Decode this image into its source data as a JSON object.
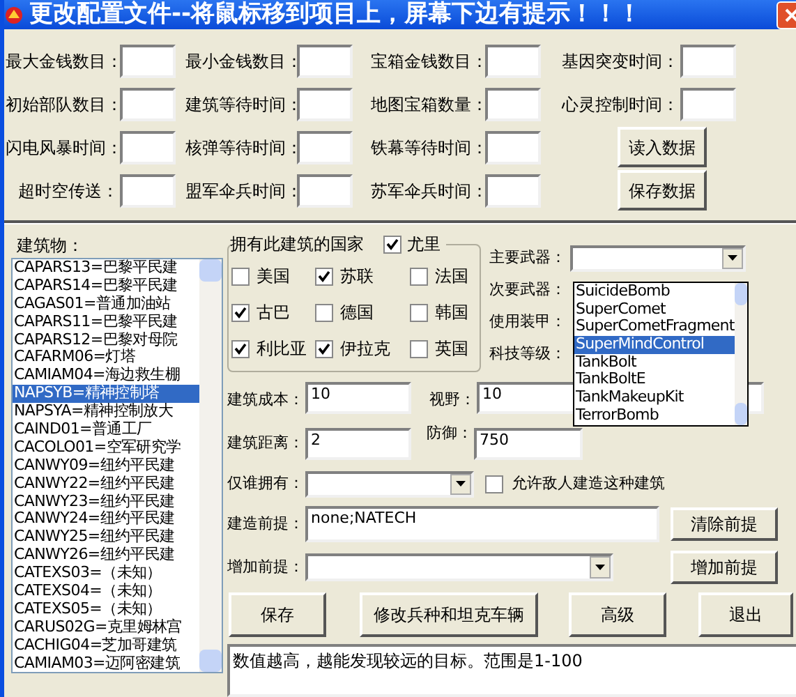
{
  "window": {
    "title": "更改配置文件--将鼠标移到项目上，屏幕下边有提示！！！"
  },
  "settings": [
    {
      "label": "最大金钱数目："
    },
    {
      "label": "最小金钱数目："
    },
    {
      "label": "宝箱金钱数目："
    },
    {
      "label": "基因突变时间："
    },
    {
      "label": "初始部队数目："
    },
    {
      "label": "建筑等待时间："
    },
    {
      "label": "地图宝箱数量："
    },
    {
      "label": "心灵控制时间："
    },
    {
      "label": "闪电风暴时间："
    },
    {
      "label": "核弹等待时间："
    },
    {
      "label": "铁幕等待时间："
    },
    {
      "label": "超时空传送："
    },
    {
      "label": "盟军伞兵时间："
    },
    {
      "label": "苏军伞兵时间："
    }
  ],
  "data_buttons": [
    "读入数据",
    "保存数据"
  ],
  "buildings": {
    "label": "建筑物：",
    "items": [
      {
        "text": "CAPARS13=巴黎平民建",
        "selected": false
      },
      {
        "text": "CAPARS14=巴黎平民建",
        "selected": false
      },
      {
        "text": "CAGAS01=普通加油站",
        "selected": false
      },
      {
        "text": "CAPARS11=巴黎平民建",
        "selected": false
      },
      {
        "text": "CAPARS12=巴黎对母院",
        "selected": false
      },
      {
        "text": "CAFARM06=灯塔",
        "selected": false
      },
      {
        "text": "CAMIAM04=海边救生棚",
        "selected": false
      },
      {
        "text": "NAPSYB=精神控制塔",
        "selected": true
      },
      {
        "text": "NAPSYA=精神控制放大",
        "selected": false
      },
      {
        "text": "CAIND01=普通工厂",
        "selected": false
      },
      {
        "text": "CACOLO01=空军研究学",
        "selected": false
      },
      {
        "text": "CANWY09=纽约平民建",
        "selected": false
      },
      {
        "text": "CANWY22=纽约平民建",
        "selected": false
      },
      {
        "text": "CANWY23=纽约平民建",
        "selected": false
      },
      {
        "text": "CANWY24=纽约平民建",
        "selected": false
      },
      {
        "text": "CANWY25=纽约平民建",
        "selected": false
      },
      {
        "text": "CANWY26=纽约平民建",
        "selected": false
      },
      {
        "text": "CATEXS03=（未知）",
        "selected": false
      },
      {
        "text": "CATEXS04=（未知）",
        "selected": false
      },
      {
        "text": "CATEXS05=（未知）",
        "selected": false
      },
      {
        "text": "CARUS02G=克里姆林宫",
        "selected": false
      },
      {
        "text": "CACHIG04=芝加哥建筑",
        "selected": false
      },
      {
        "text": "CAMIAM03=迈阿密建筑",
        "selected": false
      }
    ]
  },
  "countries": {
    "title": "拥有此建筑的国家",
    "legend_item": {
      "label": "尤里",
      "checked": true
    },
    "items": [
      {
        "label": "美国",
        "checked": false
      },
      {
        "label": "苏联",
        "checked": true
      },
      {
        "label": "法国",
        "checked": false
      },
      {
        "label": "古巴",
        "checked": true
      },
      {
        "label": "德国",
        "checked": false
      },
      {
        "label": "韩国",
        "checked": false
      },
      {
        "label": "利比亚",
        "checked": true
      },
      {
        "label": "伊拉克",
        "checked": true
      },
      {
        "label": "英国",
        "checked": false
      }
    ]
  },
  "weapons": {
    "labels": [
      "主要武器：",
      "次要武器：",
      "使用装甲：",
      "科技等级："
    ],
    "dropdown_items": [
      {
        "text": "SuicideBomb",
        "selected": false
      },
      {
        "text": "SuperComet",
        "selected": false
      },
      {
        "text": "SuperCometFragment",
        "selected": false
      },
      {
        "text": "SuperMindControl",
        "selected": true
      },
      {
        "text": "TankBolt",
        "selected": false
      },
      {
        "text": "TankBoltE",
        "selected": false
      },
      {
        "text": "TankMakeupKit",
        "selected": false
      },
      {
        "text": "TerrorBomb",
        "selected": false
      }
    ]
  },
  "stats": [
    {
      "label": "建筑成本：",
      "value": "10"
    },
    {
      "label": "视野：",
      "value": "10"
    },
    {
      "label": "建筑距离：",
      "value": "2"
    },
    {
      "label": "防御：",
      "value": "750"
    }
  ],
  "owner": {
    "label": "仅谁拥有："
  },
  "allow_enemy": {
    "label": "允许敌人建造这种建筑",
    "checked": false
  },
  "prerequisite": {
    "label": "建造前提：",
    "value": "none;NATECH",
    "button": "清除前提"
  },
  "add_prerequisite": {
    "label": "增加前提：",
    "button": "增加前提"
  },
  "actions": [
    "保存",
    "修改兵种和坦克车辆",
    "高级",
    "退出"
  ],
  "hint": "数值越高，越能发现较远的目标。范围是1-100"
}
